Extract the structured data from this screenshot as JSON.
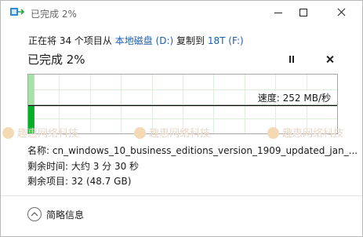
{
  "window": {
    "title": "已完成 2%"
  },
  "operation": {
    "prefix": "正在将 34 个项目从",
    "source": "本地磁盘 (D:)",
    "middle": "复制到",
    "destination": "18T (F:)"
  },
  "progress": {
    "title": "已完成 2%",
    "percent": 2,
    "speed_label": "速度: 252 MB/秒"
  },
  "details": {
    "name_label": "名称:",
    "name_value": "cn_windows_10_business_editions_version_1909_updated_jan_...",
    "time_label": "剩余时间:",
    "time_value": "大约 3 分 30 秒",
    "items_label": "剩余项目:",
    "items_value": "32 (48.7 GB)"
  },
  "footer": {
    "less_details_label": "简略信息"
  },
  "watermark": {
    "text": "趣惠网络科技"
  },
  "colors": {
    "progress_fill": "#06b025",
    "progress_fill_light": "#a8e2a8",
    "link": "#1a5fb4",
    "grid": "#dcefdc"
  },
  "icons": {
    "app": "copy-progress-icon",
    "pause": "pause-icon",
    "cancel": "close-icon",
    "less_details": "chevron-up-icon"
  }
}
